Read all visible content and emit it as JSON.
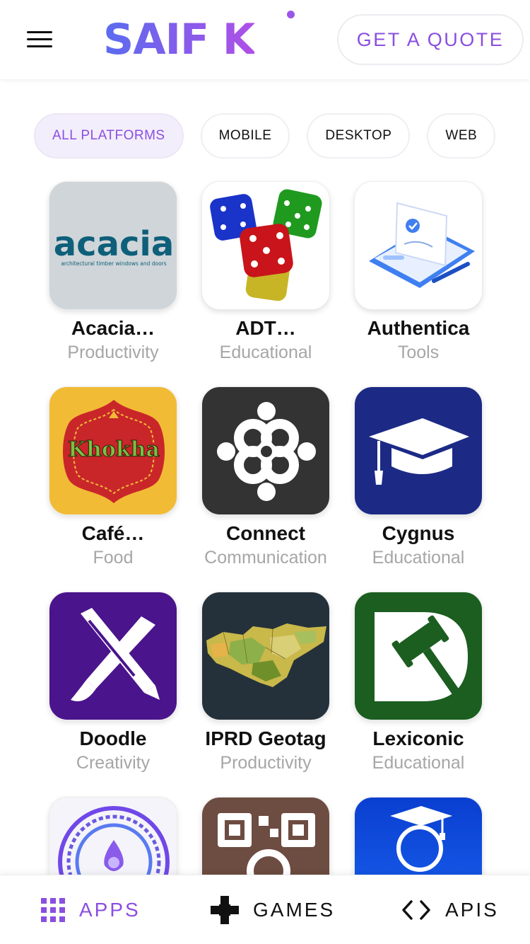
{
  "header": {
    "logo_text": "SAIF K",
    "quote_label": "GET A QUOTE"
  },
  "filters": [
    {
      "label": "ALL PLATFORMS",
      "active": true
    },
    {
      "label": "MOBILE"
    },
    {
      "label": "DESKTOP"
    },
    {
      "label": "WEB"
    }
  ],
  "apps": [
    {
      "name": "Acacia…",
      "category": "Productivity",
      "icon": "acacia-logo-icon",
      "icon_text": "acacia",
      "icon_subtext": "architectural timber windows and doors"
    },
    {
      "name": "ADT…",
      "category": "Educational",
      "icon": "dice-icon"
    },
    {
      "name": "Authentica",
      "category": "Tools",
      "icon": "document-signature-icon"
    },
    {
      "name": "Café…",
      "category": "Food",
      "icon": "khokha-logo-icon",
      "icon_text": "Khokha"
    },
    {
      "name": "Connect",
      "category": "Communication",
      "icon": "connect-knot-icon"
    },
    {
      "name": "Cygnus",
      "category": "Educational",
      "icon": "graduation-cap-icon"
    },
    {
      "name": "Doodle",
      "category": "Creativity",
      "icon": "pencil-brush-icon"
    },
    {
      "name": "IPRD Geotag",
      "category": "Productivity",
      "icon": "map-icon"
    },
    {
      "name": "Lexiconic",
      "category": "Educational",
      "icon": "gavel-icon"
    },
    {
      "name": "",
      "category": "",
      "icon": "compass-icon"
    },
    {
      "name": "",
      "category": "",
      "icon": "qr-search-icon"
    },
    {
      "name": "",
      "category": "",
      "icon": "student-reading-icon"
    }
  ],
  "bottom_nav": {
    "apps": "APPS",
    "games": "GAMES",
    "apis": "APIS"
  },
  "colors": {
    "accent": "#8a4fe0",
    "chip_active_bg": "#f3eefb"
  }
}
